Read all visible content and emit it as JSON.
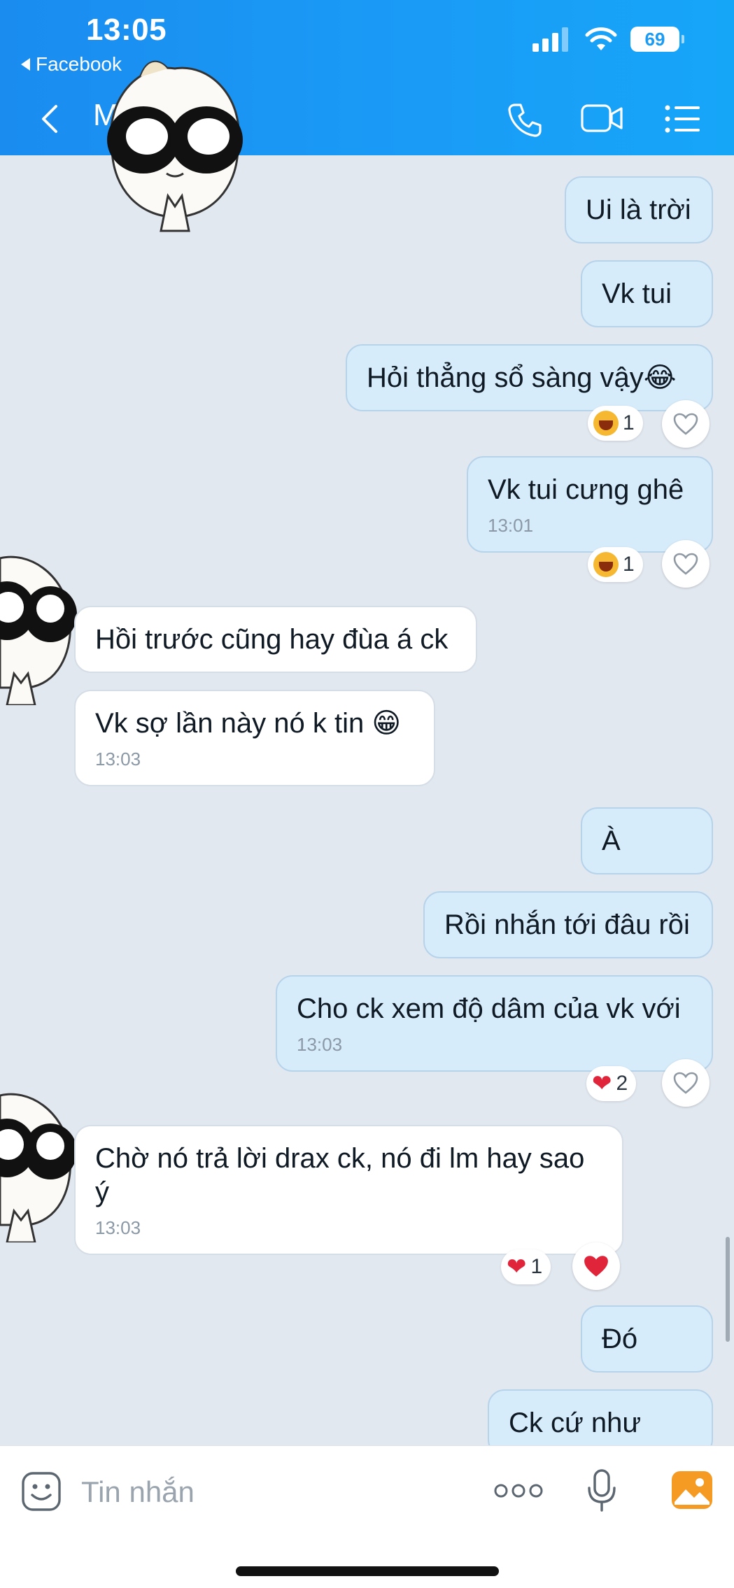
{
  "status_bar": {
    "time": "13:05",
    "back_app": "Facebook",
    "battery": "69"
  },
  "header": {
    "contact_initial": "M"
  },
  "messages": [
    {
      "text": "Ui là trời"
    },
    {
      "text": "Vk tui"
    },
    {
      "text": "Hỏi thẳng sổ sàng vậy😂",
      "reaction_count": "1"
    },
    {
      "text": "Vk tui cưng ghê",
      "time": "13:01",
      "reaction_count": "1"
    },
    {
      "text": "Hồi trước cũng hay đùa á ck"
    },
    {
      "text": "Vk sợ lần này nó k tin 😁",
      "time": "13:03"
    },
    {
      "text": "À"
    },
    {
      "text": "Rồi nhắn tới đâu rồi"
    },
    {
      "text": "Cho ck xem độ dâm của vk với",
      "time": "13:03",
      "reaction_count": "2"
    },
    {
      "text": "Chờ nó trả lời drax ck, nó đi lm hay sao ý",
      "time": "13:03",
      "reaction_count": "1"
    },
    {
      "text": "Đó"
    },
    {
      "text": "Ck cứ như vậy"
    }
  ],
  "input": {
    "placeholder": "Tin nhắn"
  },
  "colors": {
    "header": "#1a9bf6",
    "outgoing_bubble": "#d6ecfb",
    "incoming_bubble": "#ffffff",
    "background": "#e2e8f0",
    "heart": "#e0243a",
    "gallery_icon": "#f59a23"
  },
  "icons": [
    "back-icon",
    "phone-icon",
    "video-icon",
    "menu-icon",
    "sticker-icon",
    "more-icon",
    "microphone-icon",
    "gallery-icon"
  ]
}
